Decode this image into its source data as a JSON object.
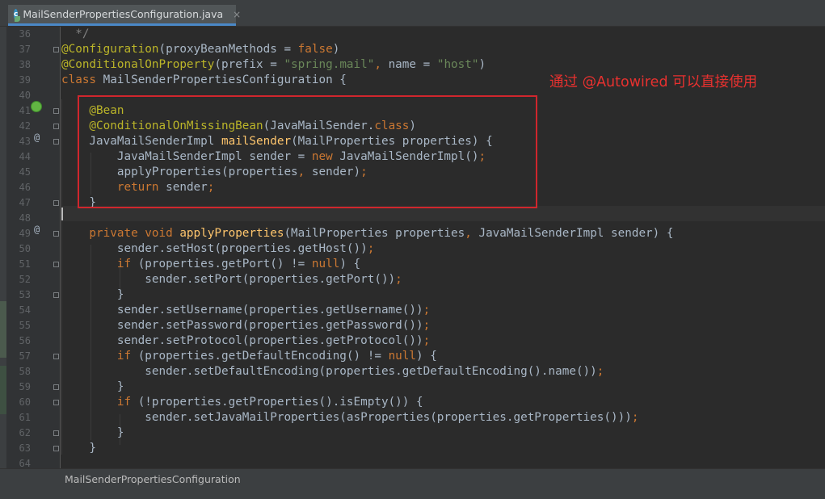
{
  "tab": {
    "label": "MailSenderPropertiesConfiguration.java",
    "icon": "spring-class-icon",
    "close": "×"
  },
  "annotation": "通过 @Autowired 可以直接使用",
  "breadcrumb": "MailSenderPropertiesConfiguration",
  "gutter_marks": {
    "override": "@"
  },
  "colors": {
    "keyword": "#cc7832",
    "annotation": "#bbb529",
    "method": "#ffc66d",
    "string": "#6a8759",
    "comment": "#808080",
    "text": "#a9b7c6",
    "highlight_box": "#d0262d"
  },
  "code": [
    {
      "n": "36",
      "tokens": [
        {
          "c": "cm",
          "t": "  */"
        }
      ]
    },
    {
      "n": "37",
      "tokens": [
        {
          "c": "an",
          "t": "@Configuration"
        },
        {
          "c": "pl",
          "t": "(proxyBeanMethods = "
        },
        {
          "c": "kw",
          "t": "false"
        },
        {
          "c": "pl",
          "t": ")"
        }
      ]
    },
    {
      "n": "38",
      "tokens": [
        {
          "c": "an",
          "t": "@ConditionalOnProperty"
        },
        {
          "c": "pl",
          "t": "(prefix = "
        },
        {
          "c": "st",
          "t": "\"spring.mail\""
        },
        {
          "c": "kw",
          "t": ", "
        },
        {
          "c": "pl",
          "t": "name = "
        },
        {
          "c": "st",
          "t": "\"host\""
        },
        {
          "c": "pl",
          "t": ")"
        }
      ]
    },
    {
      "n": "39",
      "tokens": [
        {
          "c": "kw",
          "t": "class "
        },
        {
          "c": "pl",
          "t": "MailSenderPropertiesConfiguration {"
        }
      ]
    },
    {
      "n": "40",
      "tokens": []
    },
    {
      "n": "41",
      "tokens": [
        {
          "c": "an",
          "t": "    @Bean"
        }
      ]
    },
    {
      "n": "42",
      "tokens": [
        {
          "c": "an",
          "t": "    @ConditionalOnMissingBean"
        },
        {
          "c": "pl",
          "t": "(JavaMailSender."
        },
        {
          "c": "kw",
          "t": "class"
        },
        {
          "c": "pl",
          "t": ")"
        }
      ]
    },
    {
      "n": "43",
      "tokens": [
        {
          "c": "pl",
          "t": "    JavaMailSenderImpl "
        },
        {
          "c": "fn",
          "t": "mailSender"
        },
        {
          "c": "pl",
          "t": "(MailProperties properties) {"
        }
      ]
    },
    {
      "n": "44",
      "tokens": [
        {
          "c": "pl",
          "t": "        JavaMailSenderImpl sender = "
        },
        {
          "c": "kw",
          "t": "new "
        },
        {
          "c": "pl",
          "t": "JavaMailSenderImpl()"
        },
        {
          "c": "kw",
          "t": ";"
        }
      ]
    },
    {
      "n": "45",
      "tokens": [
        {
          "c": "pl",
          "t": "        applyProperties(properties"
        },
        {
          "c": "kw",
          "t": ", "
        },
        {
          "c": "pl",
          "t": "sender)"
        },
        {
          "c": "kw",
          "t": ";"
        }
      ]
    },
    {
      "n": "46",
      "tokens": [
        {
          "c": "kw",
          "t": "        return "
        },
        {
          "c": "pl",
          "t": "sender"
        },
        {
          "c": "kw",
          "t": ";"
        }
      ]
    },
    {
      "n": "47",
      "tokens": [
        {
          "c": "pl",
          "t": "    }"
        }
      ]
    },
    {
      "n": "48",
      "tokens": []
    },
    {
      "n": "49",
      "tokens": [
        {
          "c": "kw",
          "t": "    private void "
        },
        {
          "c": "fn",
          "t": "applyProperties"
        },
        {
          "c": "pl",
          "t": "(MailProperties properties"
        },
        {
          "c": "kw",
          "t": ", "
        },
        {
          "c": "pl",
          "t": "JavaMailSenderImpl sender) {"
        }
      ]
    },
    {
      "n": "50",
      "tokens": [
        {
          "c": "pl",
          "t": "        sender.setHost(properties.getHost())"
        },
        {
          "c": "kw",
          "t": ";"
        }
      ]
    },
    {
      "n": "51",
      "tokens": [
        {
          "c": "kw",
          "t": "        if "
        },
        {
          "c": "pl",
          "t": "(properties.getPort() != "
        },
        {
          "c": "kw",
          "t": "null"
        },
        {
          "c": "pl",
          "t": ") {"
        }
      ]
    },
    {
      "n": "52",
      "tokens": [
        {
          "c": "pl",
          "t": "            sender.setPort(properties.getPort())"
        },
        {
          "c": "kw",
          "t": ";"
        }
      ]
    },
    {
      "n": "53",
      "tokens": [
        {
          "c": "pl",
          "t": "        }"
        }
      ]
    },
    {
      "n": "54",
      "tokens": [
        {
          "c": "pl",
          "t": "        sender.setUsername(properties.getUsername())"
        },
        {
          "c": "kw",
          "t": ";"
        }
      ]
    },
    {
      "n": "55",
      "tokens": [
        {
          "c": "pl",
          "t": "        sender.setPassword(properties.getPassword())"
        },
        {
          "c": "kw",
          "t": ";"
        }
      ]
    },
    {
      "n": "56",
      "tokens": [
        {
          "c": "pl",
          "t": "        sender.setProtocol(properties.getProtocol())"
        },
        {
          "c": "kw",
          "t": ";"
        }
      ]
    },
    {
      "n": "57",
      "tokens": [
        {
          "c": "kw",
          "t": "        if "
        },
        {
          "c": "pl",
          "t": "(properties.getDefaultEncoding() != "
        },
        {
          "c": "kw",
          "t": "null"
        },
        {
          "c": "pl",
          "t": ") {"
        }
      ]
    },
    {
      "n": "58",
      "tokens": [
        {
          "c": "pl",
          "t": "            sender.setDefaultEncoding(properties.getDefaultEncoding().name())"
        },
        {
          "c": "kw",
          "t": ";"
        }
      ]
    },
    {
      "n": "59",
      "tokens": [
        {
          "c": "pl",
          "t": "        }"
        }
      ]
    },
    {
      "n": "60",
      "tokens": [
        {
          "c": "kw",
          "t": "        if "
        },
        {
          "c": "pl",
          "t": "(!properties.getProperties().isEmpty()) {"
        }
      ]
    },
    {
      "n": "61",
      "tokens": [
        {
          "c": "pl",
          "t": "            sender.setJavaMailProperties(asProperties(properties.getProperties()))"
        },
        {
          "c": "kw",
          "t": ";"
        }
      ]
    },
    {
      "n": "62",
      "tokens": [
        {
          "c": "pl",
          "t": "        }"
        }
      ]
    },
    {
      "n": "63",
      "tokens": [
        {
          "c": "pl",
          "t": "    }"
        }
      ]
    },
    {
      "n": "64",
      "tokens": []
    }
  ]
}
